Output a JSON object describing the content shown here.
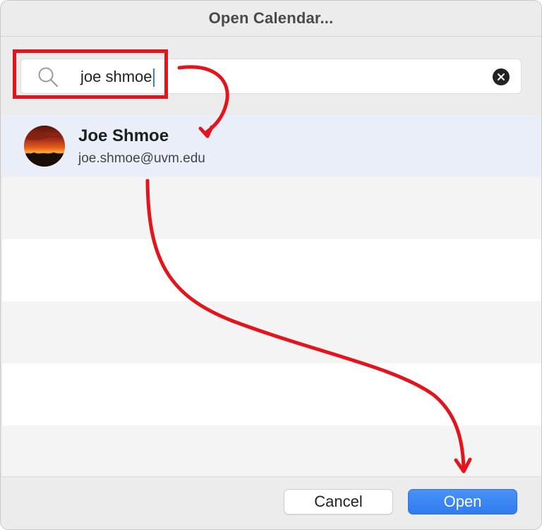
{
  "dialog": {
    "title": "Open Calendar..."
  },
  "search": {
    "value": "joe shmoe",
    "search_icon": "search-icon",
    "clear_icon": "clear-circle-icon"
  },
  "results": [
    {
      "name": "Joe Shmoe",
      "email": "joe.shmoe@uvm.edu",
      "avatar": "sunset-photo",
      "selected": true
    }
  ],
  "footer": {
    "cancel_label": "Cancel",
    "open_label": "Open"
  },
  "annotation": {
    "color": "#e3141b"
  },
  "colors": {
    "accent": "#2f7cf0",
    "selection": "#e9eef8"
  }
}
